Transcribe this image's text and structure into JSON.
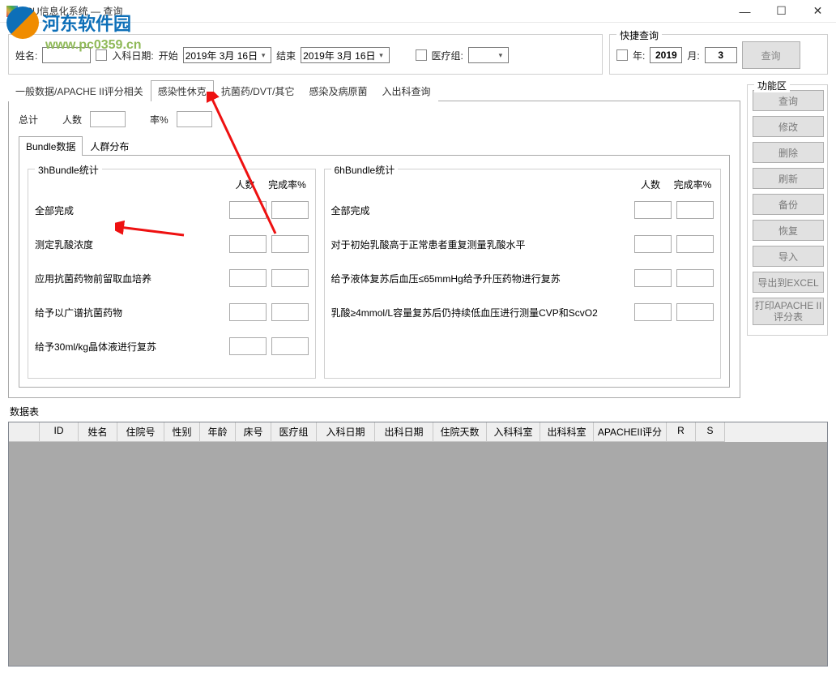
{
  "window": {
    "title": "ICU信息化系统 — 查询"
  },
  "filter": {
    "name_label": "姓名:",
    "name_value": "",
    "admit_label": "入科日期:",
    "start_label": "开始",
    "start_date": "2019年 3月 16日",
    "end_label": "结束",
    "end_date": "2019年 3月 16日",
    "group_label": "医疗组:"
  },
  "quick": {
    "title": "快捷查询",
    "year_label": "年:",
    "year_value": "2019",
    "month_label": "月:",
    "month_value": "3",
    "query_btn": "查询"
  },
  "sidebar": {
    "title": "功能区",
    "btns": [
      "查询",
      "修改",
      "删除",
      "刷新",
      "备份",
      "恢复",
      "导入",
      "导出到EXCEL",
      "打印APACHE II评分表"
    ]
  },
  "tabs": [
    "一般数据/APACHE II评分相关",
    "感染性休克",
    "抗菌药/DVT/其它",
    "感染及病原菌",
    "入出科查询"
  ],
  "active_tab": 1,
  "total": {
    "label": "总计",
    "count_label": "人数",
    "rate_label": "率%"
  },
  "subtabs": [
    "Bundle数据",
    "人群分布"
  ],
  "bundle3h": {
    "title": "3hBundle统计",
    "col1": "人数",
    "col2": "完成率%",
    "rows": [
      "全部完成",
      "测定乳酸浓度",
      "应用抗菌药物前留取血培养",
      "给予以广谱抗菌药物",
      "给予30ml/kg晶体液进行复苏"
    ]
  },
  "bundle6h": {
    "title": "6hBundle统计",
    "col1": "人数",
    "col2": "完成率%",
    "rows": [
      "全部完成",
      "对于初始乳酸高于正常患者重复测量乳酸水平",
      "给予液体复苏后血压≤65mmHg给予升压药物进行复苏",
      "乳酸≥4mmol/L容量复苏后仍持续低血压进行测量CVP和ScvO2"
    ]
  },
  "grid": {
    "title": "数据表",
    "columns": [
      "ID",
      "姓名",
      "住院号",
      "性别",
      "年龄",
      "床号",
      "医疗组",
      "入科日期",
      "出科日期",
      "住院天数",
      "入科科室",
      "出科科室",
      "APACHEII评分",
      "R",
      "S"
    ]
  },
  "watermark": {
    "brand": "河东软件园",
    "url": "www.pc0359.cn"
  }
}
